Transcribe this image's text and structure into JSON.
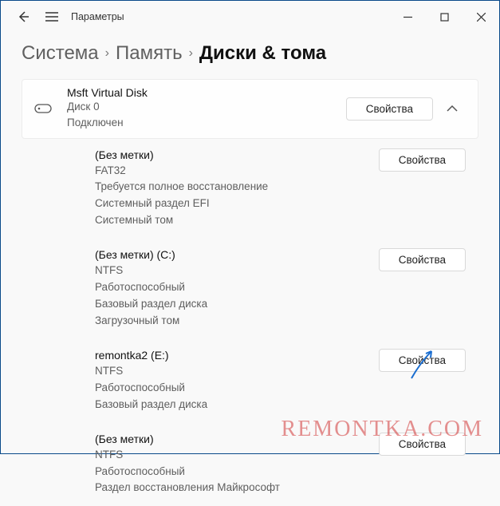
{
  "titlebar": {
    "app_title": "Параметры"
  },
  "breadcrumb": {
    "items": [
      "Система",
      "Память",
      "Диски & тома"
    ]
  },
  "disk": {
    "title": "Msft Virtual Disk",
    "line1": "Диск 0",
    "line2": "Подключен",
    "properties_label": "Свойства"
  },
  "volumes": [
    {
      "title": "(Без метки)",
      "lines": [
        "FAT32",
        "Требуется полное восстановление",
        "Системный раздел EFI",
        "Системный том"
      ],
      "properties_label": "Свойства"
    },
    {
      "title": "(Без метки) (C:)",
      "lines": [
        "NTFS",
        "Работоспособный",
        "Базовый раздел диска",
        "Загрузочный том"
      ],
      "properties_label": "Свойства"
    },
    {
      "title": "remontka2 (E:)",
      "lines": [
        "NTFS",
        "Работоспособный",
        "Базовый раздел диска"
      ],
      "properties_label": "Свойства"
    },
    {
      "title": "(Без метки)",
      "lines": [
        "NTFS",
        "Работоспособный",
        "Раздел восстановления Майкрософт"
      ],
      "properties_label": "Свойства"
    }
  ],
  "watermark": "REMONTKA.COM"
}
